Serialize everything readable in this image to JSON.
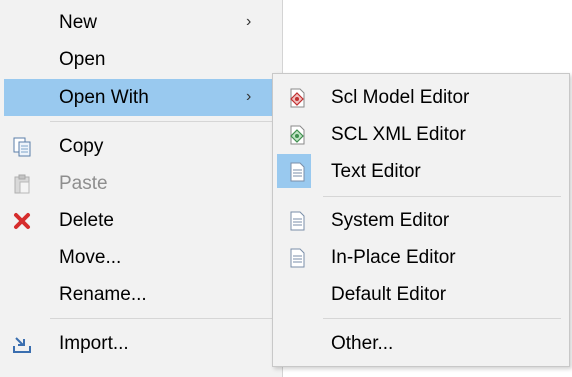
{
  "main_menu": {
    "items": [
      {
        "label": "New",
        "submenu": true
      },
      {
        "label": "Open"
      },
      {
        "label": "Open With",
        "submenu": true,
        "highlighted": true
      },
      {
        "label": "Copy",
        "icon": "copy-icon"
      },
      {
        "label": "Paste",
        "icon": "paste-icon",
        "disabled": true
      },
      {
        "label": "Delete",
        "icon": "delete-icon"
      },
      {
        "label": "Move..."
      },
      {
        "label": "Rename..."
      },
      {
        "label": "Import...",
        "icon": "import-icon"
      }
    ],
    "arrow_glyph": "›"
  },
  "open_with_menu": {
    "items": [
      {
        "label": "Scl Model Editor",
        "icon": "scl-model-editor-icon"
      },
      {
        "label": "SCL XML Editor",
        "icon": "scl-xml-editor-icon"
      },
      {
        "label": "Text Editor",
        "icon": "text-file-icon",
        "selected": true
      },
      {
        "label": "System Editor",
        "icon": "text-file-icon"
      },
      {
        "label": "In-Place Editor",
        "icon": "text-file-icon"
      },
      {
        "label": "Default Editor"
      },
      {
        "label": "Other..."
      }
    ]
  },
  "colors": {
    "menu_background": "#f2f2f2",
    "highlight": "#99c9ef",
    "disabled_text": "#8e8e8e",
    "delete_red": "#d62d2d"
  }
}
